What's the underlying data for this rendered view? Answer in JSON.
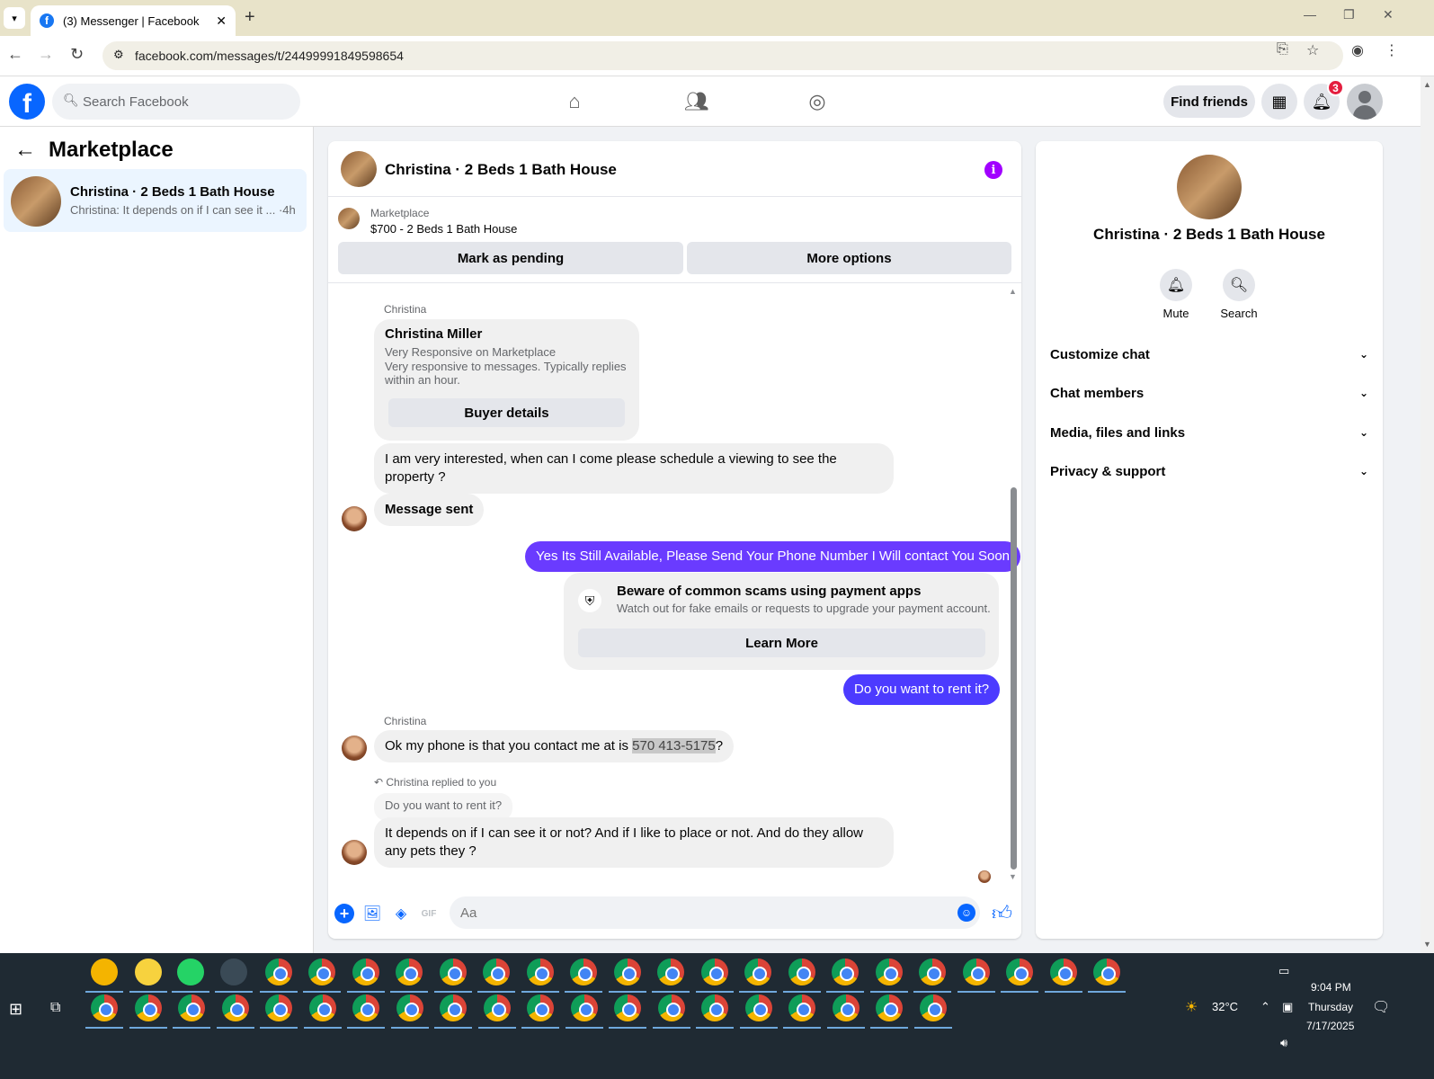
{
  "browser": {
    "tab_title": "(3) Messenger | Facebook",
    "tab_close": "✕",
    "new_tab": "+",
    "url": "facebook.com/messages/t/24499991849598654"
  },
  "header": {
    "search_placeholder": "Search Facebook",
    "find_friends": "Find friends",
    "notification_count": "3"
  },
  "sidebar": {
    "title": "Marketplace",
    "conversation": {
      "name": "Christina · 2 Beds 1 Bath House",
      "snippet": "Christina: It depends on if I can see it ... ·4h"
    }
  },
  "chat": {
    "title": "Christina · 2 Beds 1 Bath House",
    "marketplace_label": "Marketplace",
    "listing": "$700 - 2 Beds 1 Bath House",
    "mark_pending": "Mark as pending",
    "more_options": "More options",
    "messages": {
      "sender1": "Christina",
      "profile_name": "Christina Miller",
      "profile_line1": "Very Responsive on Marketplace",
      "profile_line2": "Very responsive to messages. Typically replies",
      "profile_line3": "within an hour.",
      "buyer_details": "Buyer details",
      "msg_interest": "I am very interested, when can I come please schedule a viewing to see the property ?",
      "msg_sent": "Message sent",
      "out_available": "Yes Its Still Available, Please Send Your Phone Number I Will contact You Soon",
      "scam_title": "Beware of common scams using payment apps",
      "scam_text": "Watch out for fake emails or requests to upgrade your payment account.",
      "learn_more": "Learn More",
      "out_rent": "Do you want to rent it?",
      "sender2": "Christina",
      "msg_phone_prefix": "Ok my phone is that you contact me at is ",
      "msg_phone_number": "570 413-5175",
      "msg_phone_suffix": "?",
      "replied_label": "Christina replied to you",
      "quoted": "Do you want to rent it?",
      "msg_depends": "It depends on if I can see it or not? And if I like to place or not. And do they allow any pets they ?"
    },
    "composer_placeholder": "Aa"
  },
  "right_panel": {
    "name": "Christina · 2 Beds 1 Bath House",
    "mute": "Mute",
    "search": "Search",
    "sections": [
      "Customize chat",
      "Chat members",
      "Media, files and links",
      "Privacy & support"
    ]
  },
  "taskbar": {
    "temperature": "32°C",
    "time": "9:04 PM",
    "day": "Thursday",
    "date": "7/17/2025"
  },
  "colors": {
    "accent": "#0866ff",
    "outgoing_bubble": "#6a3bff",
    "info_icon": "#a100ff",
    "badge": "#e41e3f"
  }
}
